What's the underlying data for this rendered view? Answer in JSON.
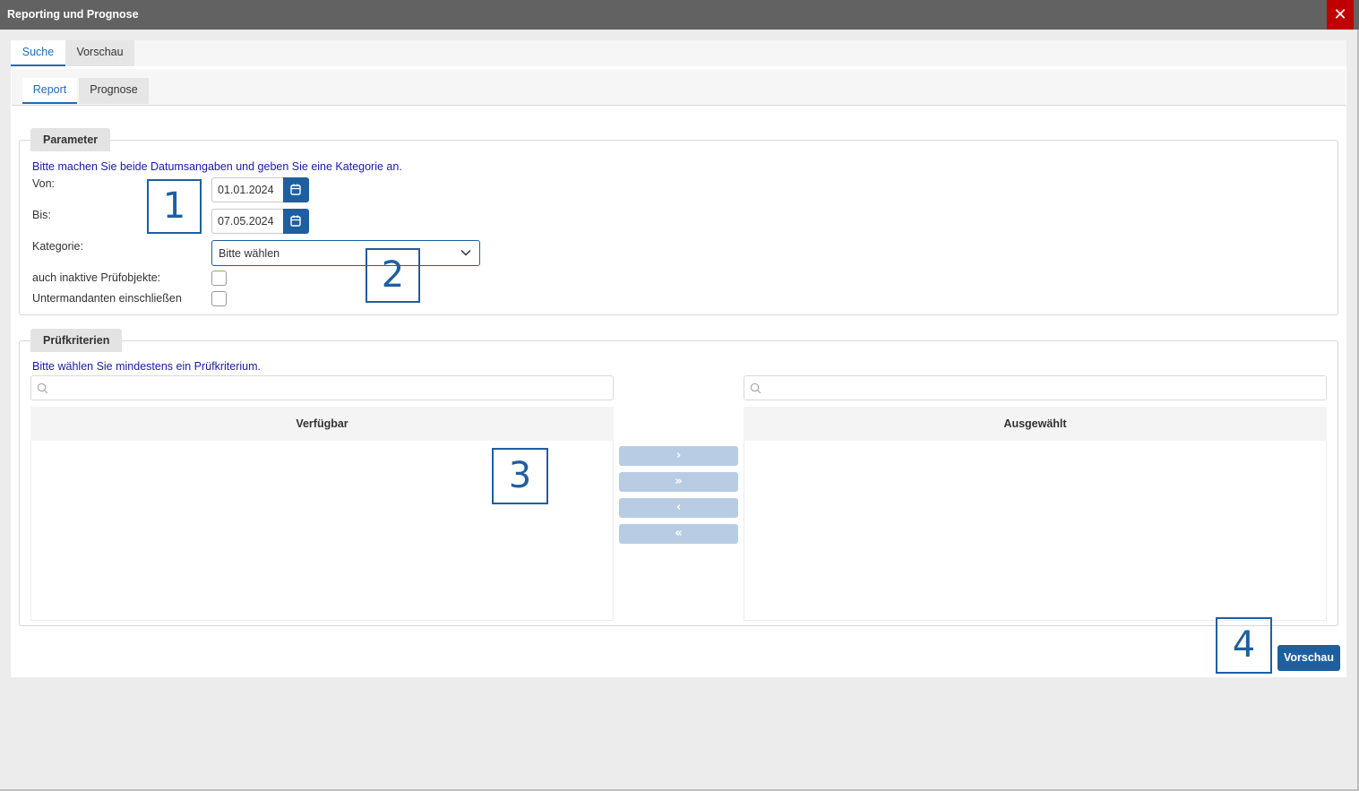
{
  "window": {
    "title": "Reporting und Prognose",
    "close_glyph": "✕"
  },
  "tabs_main": [
    {
      "label": "Suche",
      "active": true
    },
    {
      "label": "Vorschau",
      "active": false
    }
  ],
  "tabs_sub": [
    {
      "label": "Report",
      "active": true
    },
    {
      "label": "Prognose",
      "active": false
    }
  ],
  "parameter": {
    "legend": "Parameter",
    "hint": "Bitte machen Sie beide Datumsangaben und geben Sie eine Kategorie an.",
    "von_label": "Von:",
    "von_value": "01.01.2024",
    "bis_label": "Bis:",
    "bis_value": "07.05.2024",
    "kategorie_label": "Kategorie:",
    "kategorie_value": "Bitte wählen",
    "inactive_label": "auch inaktive Prüfobjekte:",
    "inactive_checked": false,
    "sub_label": "Untermandanten einschließen",
    "sub_checked": false
  },
  "criteria": {
    "legend": "Prüfkriterien",
    "hint": "Bitte wählen Sie mindestens ein Prüfkriterium.",
    "available_header": "Verfügbar",
    "selected_header": "Ausgewählt",
    "available_items": [],
    "selected_items": [],
    "move_buttons": [
      "›",
      "»",
      "‹",
      "«"
    ]
  },
  "markers": [
    "1",
    "2",
    "3",
    "4"
  ],
  "footer": {
    "preview_button": "Vorschau"
  },
  "colors": {
    "accent": "#1e5fa0",
    "close": "#c00000",
    "titlebar": "#626262",
    "hint": "#1a1aa6"
  },
  "icons": {
    "date_button": "calendar-icon",
    "select": "chevron-down-icon",
    "search": "search-icon",
    "close": "close-icon"
  }
}
